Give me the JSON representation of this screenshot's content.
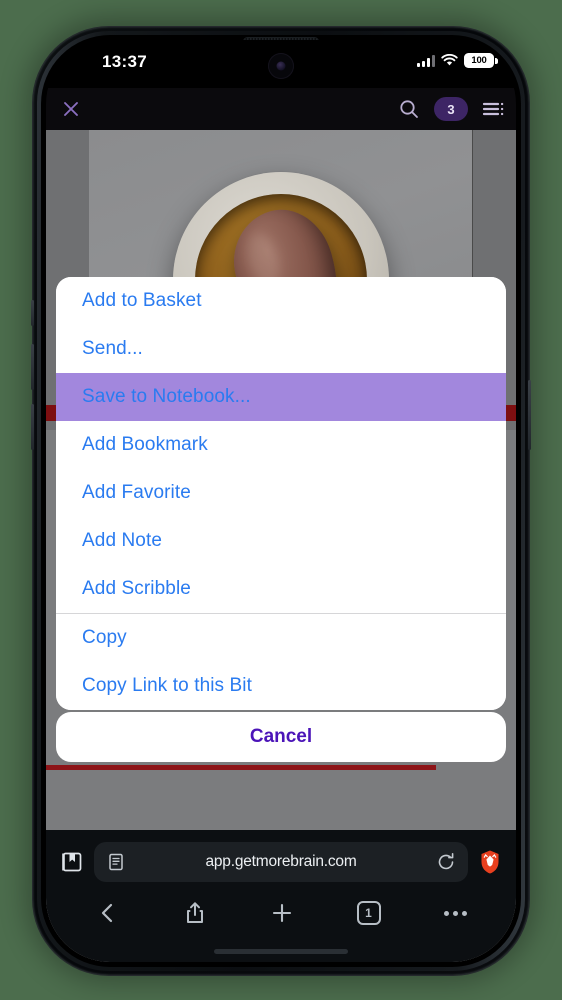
{
  "status_bar": {
    "time": "13:37",
    "battery_level": "100",
    "signal_icon": "cellular-signal-icon",
    "wifi_icon": "wifi-icon",
    "battery_icon": "battery-icon"
  },
  "app_bar": {
    "close_icon": "close-icon",
    "search_icon": "search-icon",
    "badge_count": "3",
    "menu_icon": "list-menu-icon"
  },
  "content": {
    "photo_description": "chocolate mousse quenelle in ceramic bowl"
  },
  "action_sheet": {
    "items": [
      {
        "label": "Add to Basket",
        "highlighted": false,
        "separator_after": false
      },
      {
        "label": "Send...",
        "highlighted": false,
        "separator_after": false
      },
      {
        "label": "Save to Notebook...",
        "highlighted": true,
        "separator_after": false
      },
      {
        "label": "Add Bookmark",
        "highlighted": false,
        "separator_after": false
      },
      {
        "label": "Add Favorite",
        "highlighted": false,
        "separator_after": false
      },
      {
        "label": "Add Note",
        "highlighted": false,
        "separator_after": false
      },
      {
        "label": "Add Scribble",
        "highlighted": false,
        "separator_after": true
      },
      {
        "label": "Copy",
        "highlighted": false,
        "separator_after": false
      },
      {
        "label": "Copy Link to this Bit",
        "highlighted": false,
        "separator_after": false
      }
    ],
    "cancel_label": "Cancel",
    "text_color": "#2a7bf0",
    "highlight_color": "#a287dd",
    "cancel_color": "#4b14b8"
  },
  "browser": {
    "bookmarks_icon": "bookmarks-book-icon",
    "reader_icon": "reader-mode-icon",
    "url": "app.getmorebrain.com",
    "reload_icon": "reload-icon",
    "shield_icon": "brave-shield-lion-icon",
    "back_icon": "back-arrow-icon",
    "share_icon": "share-icon",
    "new_tab_icon": "plus-icon",
    "tab_count": "1",
    "more_icon": "more-options-icon"
  },
  "theme": {
    "backdrop_green": "#4c6d4d",
    "chrome_dark": "#0c0f12",
    "badge_purple": "#3d2565",
    "progress_red": "#8d1418"
  }
}
